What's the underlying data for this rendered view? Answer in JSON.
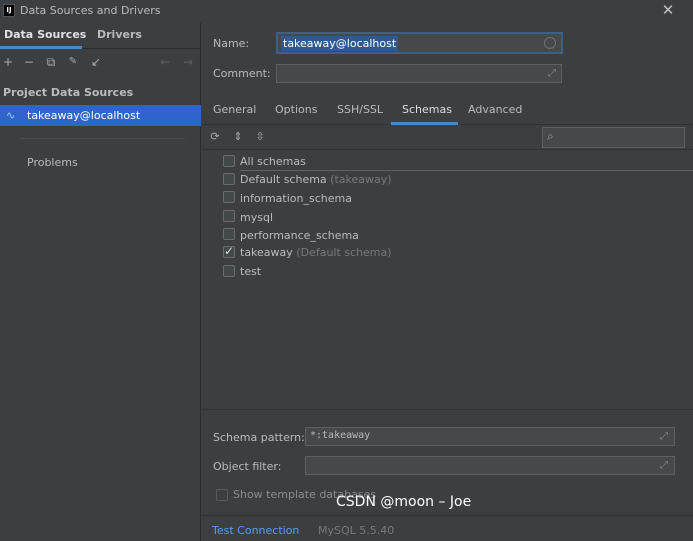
{
  "window": {
    "logo_text": "IJ",
    "title": "Data Sources and Drivers",
    "close_icon": "close-icon"
  },
  "sidebar": {
    "tabs": [
      {
        "label": "Data Sources",
        "active": true
      },
      {
        "label": "Drivers",
        "active": false
      }
    ],
    "toolbar": {
      "add": "+",
      "remove": "−",
      "duplicate": "⧉",
      "settings": "🔧",
      "import": "↙",
      "back": "←",
      "forward": "→"
    },
    "section_title": "Project Data Sources",
    "data_sources": [
      {
        "label": "takeaway@localhost",
        "selected": true,
        "icon": "mysql-dolphin-icon"
      }
    ],
    "problems_label": "Problems"
  },
  "form": {
    "name_label": "Name:",
    "name_value": "takeaway@localhost",
    "comment_label": "Comment:",
    "comment_value": ""
  },
  "tabs": [
    {
      "label": "General",
      "active": false
    },
    {
      "label": "Options",
      "active": false
    },
    {
      "label": "SSH/SSL",
      "active": false
    },
    {
      "label": "Schemas",
      "active": true
    },
    {
      "label": "Advanced",
      "active": false
    }
  ],
  "schema_toolbar": {
    "refresh": "⟳",
    "expand_all": "⇕",
    "collapse_all": "⇳",
    "search_placeholder": ""
  },
  "schemas": {
    "all_label": "All schemas",
    "items": [
      {
        "name": "Default schema",
        "hint": "(takeaway)",
        "checked": false,
        "bolt": false
      },
      {
        "name": "information_schema",
        "hint": "",
        "checked": false,
        "bolt": true
      },
      {
        "name": "mysql",
        "hint": "",
        "checked": false,
        "bolt": true
      },
      {
        "name": "performance_schema",
        "hint": "",
        "checked": false,
        "bolt": true
      },
      {
        "name": "takeaway",
        "hint": "(Default schema)",
        "checked": true,
        "bolt": false
      },
      {
        "name": "test",
        "hint": "",
        "checked": false,
        "bolt": false
      }
    ],
    "bolt_glyph": "⚡"
  },
  "bottom": {
    "schema_pattern_label": "Schema pattern:",
    "schema_pattern_value": "*:takeaway",
    "object_filter_label": "Object filter:",
    "object_filter_value": "",
    "template_label": "Show template databases",
    "template_checked": false
  },
  "footer": {
    "test_connection": "Test Connection",
    "driver_version": "MySQL 5.5.40"
  },
  "watermark": "CSDN @moon – Joe",
  "colors": {
    "background": "#3c3f41",
    "selection": "#2f65ca",
    "accent": "#4a88c7",
    "link": "#589df6",
    "bolt": "#f0a30a"
  }
}
